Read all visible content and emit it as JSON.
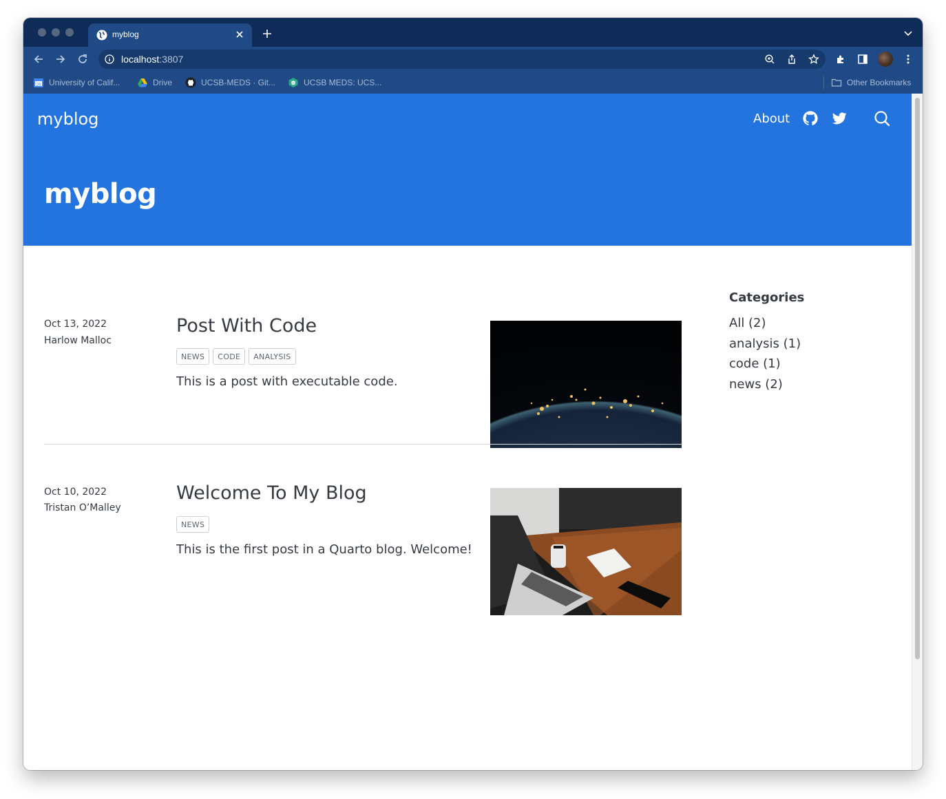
{
  "browser": {
    "tab_title": "myblog",
    "url_host": "localhost",
    "url_port": ":3807",
    "bookmarks": [
      {
        "label": "University of Calif...",
        "icon": "calendar-icon"
      },
      {
        "label": "Drive",
        "icon": "drive-icon"
      },
      {
        "label": "UCSB-MEDS · Git...",
        "icon": "github-icon"
      },
      {
        "label": "UCSB MEDS: UCS...",
        "icon": "course-icon"
      }
    ],
    "other_bookmarks": "Other Bookmarks"
  },
  "site": {
    "brand": "myblog",
    "nav": {
      "about": "About"
    },
    "hero_title": "myblog"
  },
  "posts": [
    {
      "date": "Oct 13, 2022",
      "author": "Harlow Malloc",
      "title": "Post With Code",
      "tags": [
        "NEWS",
        "CODE",
        "ANALYSIS"
      ],
      "description": "This is a post with executable code.",
      "image": "earth-at-night-image"
    },
    {
      "date": "Oct 10, 2022",
      "author": "Tristan O’Malley",
      "title": "Welcome To My Blog",
      "tags": [
        "NEWS"
      ],
      "description": "This is the first post in a Quarto blog. Welcome!",
      "image": "laptop-desk-image"
    }
  ],
  "categories": {
    "heading": "Categories",
    "items": [
      "All (2)",
      "analysis (1)",
      "code (1)",
      "news (2)"
    ]
  },
  "colors": {
    "navbar": "#2474e0",
    "browser_frame": "#0f2b58",
    "browser_toolbar": "#1f4a85",
    "text": "#343a40"
  }
}
